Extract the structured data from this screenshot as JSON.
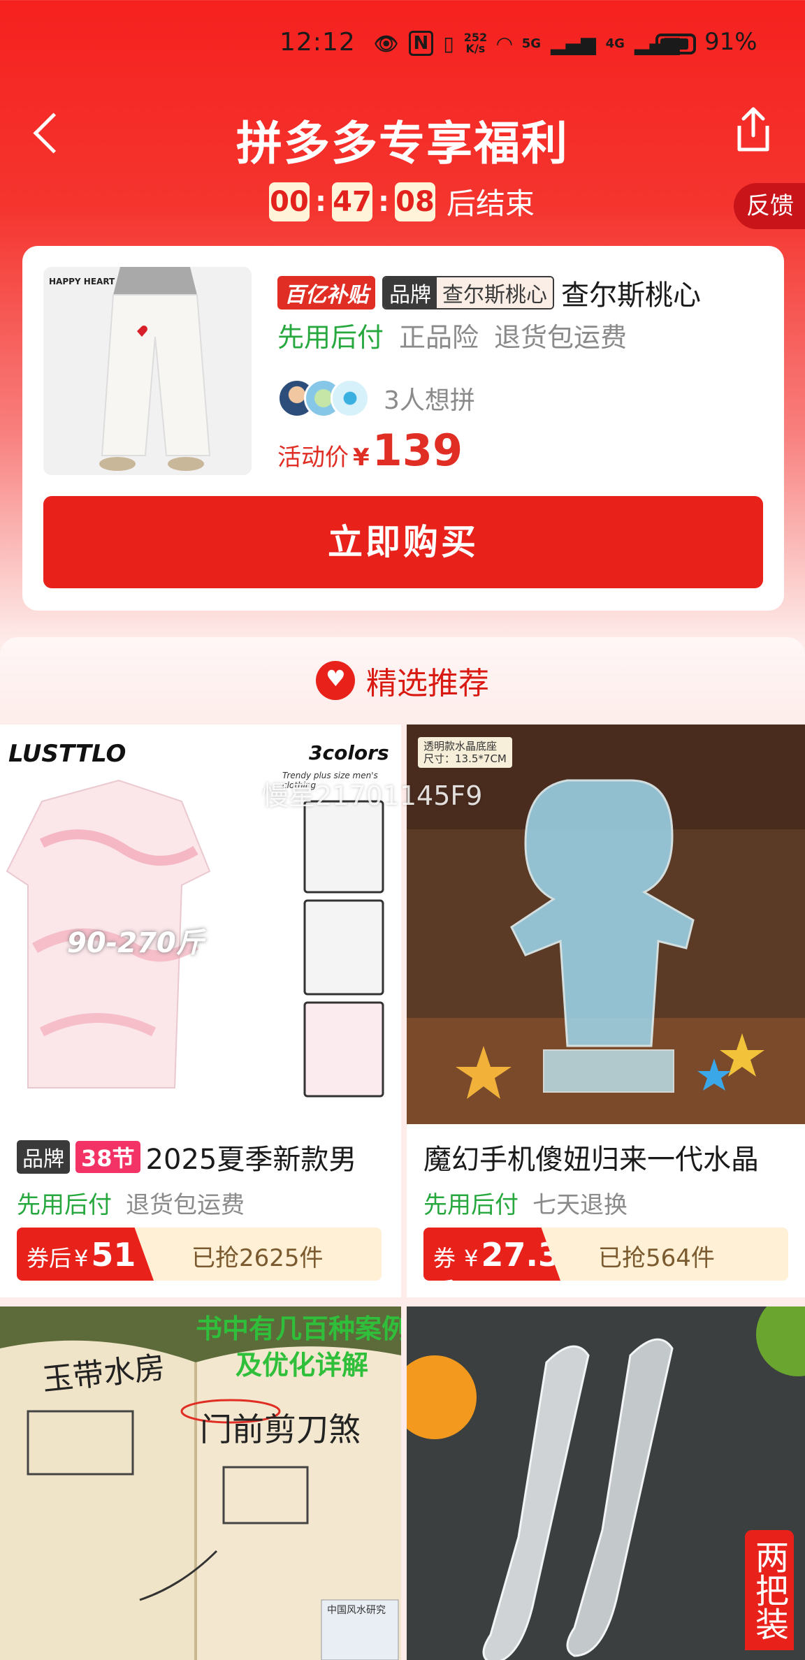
{
  "status_bar": {
    "time": "12:12",
    "net_speed": "252\nK/s",
    "signal_5g": "5G",
    "signal_4g": "4G",
    "battery": "91%"
  },
  "header": {
    "title": "拼多多专享福利",
    "countdown": {
      "h": "00",
      "m": "47",
      "s": "08",
      "sep": ":",
      "suffix": "后结束"
    },
    "feedback": "反馈"
  },
  "product": {
    "img_caption": "HAPPY HEART",
    "subsidy_tag": "百亿补贴",
    "brand_label": "品牌",
    "brand_name": "查尔斯桃心",
    "title": "查尔斯桃心",
    "perks": [
      "先用后付",
      "正品险",
      "退货包运费"
    ],
    "want_count": "3人想拼",
    "price_label": "活动价",
    "currency": "¥",
    "price": "139",
    "buy_label": "立即购买"
  },
  "recommend": {
    "title": "精选推荐",
    "items": [
      {
        "img_brand": "LUSTTLO",
        "img_colors": "3colors",
        "img_sub": "Trendy plus size men's clothing",
        "img_size": "90-270斤",
        "brand_tag": "品牌",
        "event_tag": "38节",
        "title": "2025夏季新款男",
        "perks": [
          "先用后付",
          "退货包运费"
        ],
        "coupon_label": "券后",
        "currency": "¥",
        "price": "51",
        "sold": "已抢2625件"
      },
      {
        "img_badge": "透明款水晶底座\n尺寸：13.5*7CM",
        "title": "魔幻手机傻妞归来一代水晶",
        "perks": [
          "先用后付",
          "七天退换"
        ],
        "coupon_label": "券后",
        "currency": "¥",
        "price": "27.3",
        "sold": "已抢564件"
      },
      {
        "img_text_top": "书中有几百种案例\n及优化详解",
        "img_heading_a": "玉带水房",
        "img_heading_b": "门前剪刀煞",
        "img_book": "中国风水研究"
      },
      {
        "img_side": "两把装"
      }
    ]
  },
  "watermark": "慢星21701145F9"
}
